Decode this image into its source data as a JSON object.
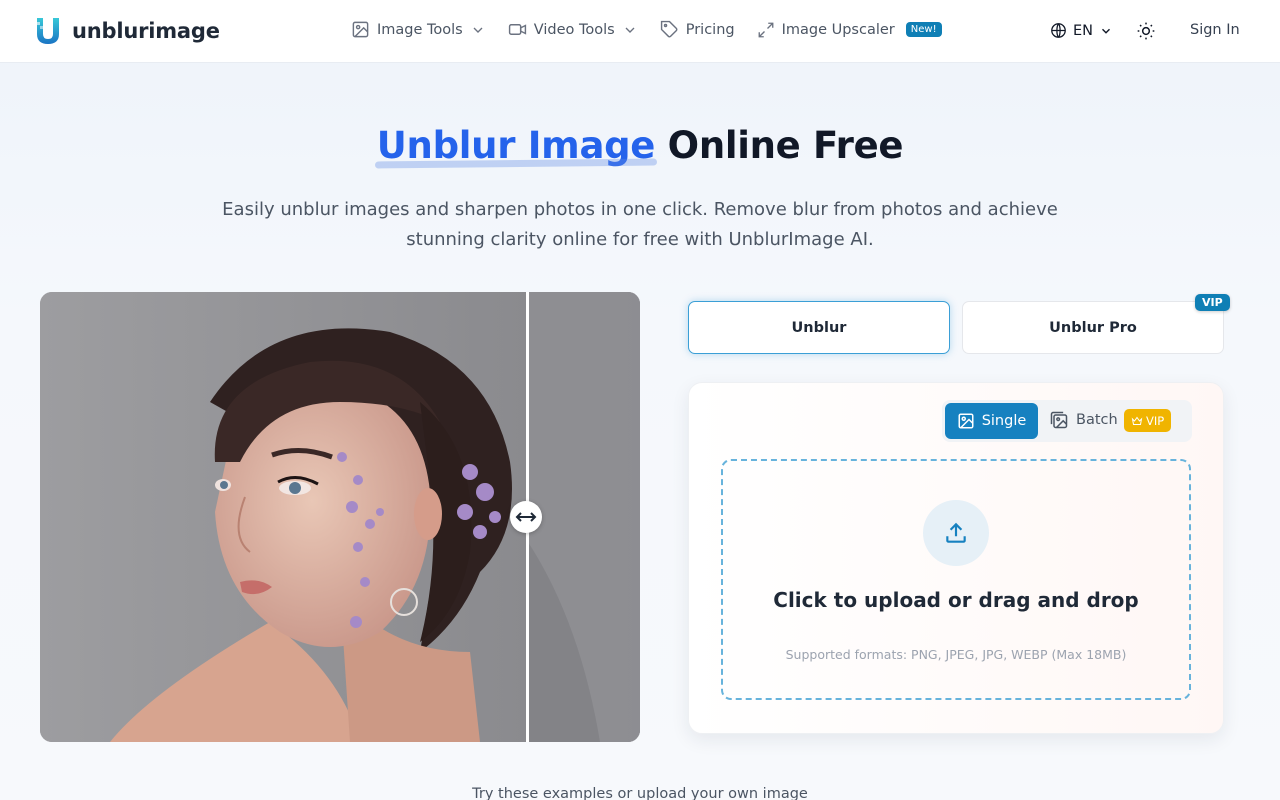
{
  "header": {
    "logo_text": "unblurimage",
    "nav": [
      {
        "label": "Image Tools",
        "icon": "image-icon",
        "has_dropdown": true
      },
      {
        "label": "Video Tools",
        "icon": "video-icon",
        "has_dropdown": true
      },
      {
        "label": "Pricing",
        "icon": "tag-icon",
        "has_dropdown": false
      },
      {
        "label": "Image Upscaler",
        "icon": "expand-icon",
        "has_dropdown": false,
        "badge": "New!"
      }
    ],
    "language": "EN",
    "theme_icon": "sun-icon",
    "sign_in": "Sign In"
  },
  "hero": {
    "title_accent": "Unblur Image",
    "title_rest": " Online Free",
    "subtitle": "Easily unblur images and sharpen photos in one click. Remove blur from photos and achieve stunning clarity online for free with UnblurImage AI."
  },
  "compare": {
    "handle_icon": "left-right-arrow-icon"
  },
  "modes": {
    "unblur": "Unblur",
    "unblur_pro": "Unblur Pro",
    "vip_badge": "VIP"
  },
  "upload": {
    "single": "Single",
    "batch": "Batch",
    "batch_vip": "VIP",
    "cta": "Click to upload or drag and drop",
    "formats": "Supported formats: PNG, JPEG, JPG, WEBP (Max 18MB)"
  },
  "examples_text": "Try these examples or upload your own image",
  "colors": {
    "accent_blue": "#2563eb",
    "brand_teal": "#0f7fb5",
    "vip_gold": "#f0b400",
    "dropzone_border": "#67b3dc"
  }
}
